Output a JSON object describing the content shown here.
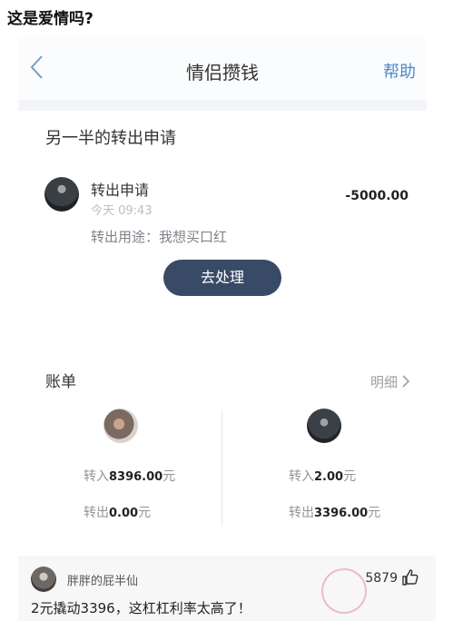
{
  "post": {
    "title": "这是爱情吗?"
  },
  "nav": {
    "title": "情侣攒钱",
    "help": "帮助",
    "back_icon": "chevron-left-icon"
  },
  "request": {
    "heading": "另一半的转出申请",
    "title": "转出申请",
    "time": "今天 09:43",
    "amount": "-5000.00",
    "purpose": "转出用途：我想买口红",
    "button": "去处理"
  },
  "bill": {
    "label": "账单",
    "detail": "明细",
    "left": {
      "in_label": "转入",
      "in_value": "8396.00",
      "in_unit": "元",
      "out_label": "转出",
      "out_value": "0.00",
      "out_unit": "元"
    },
    "right": {
      "in_label": "转入",
      "in_value": "2.00",
      "in_unit": "元",
      "out_label": "转出",
      "out_value": "3396.00",
      "out_unit": "元"
    }
  },
  "comment": {
    "user": "胖胖的屁半仙",
    "likes": "5879",
    "text": "2元撬动3396，这杠杠利率太高了！",
    "thumb_icon": "thumbs-up-icon"
  },
  "colors": {
    "accent": "#4d88c8",
    "button": "#394a67"
  }
}
